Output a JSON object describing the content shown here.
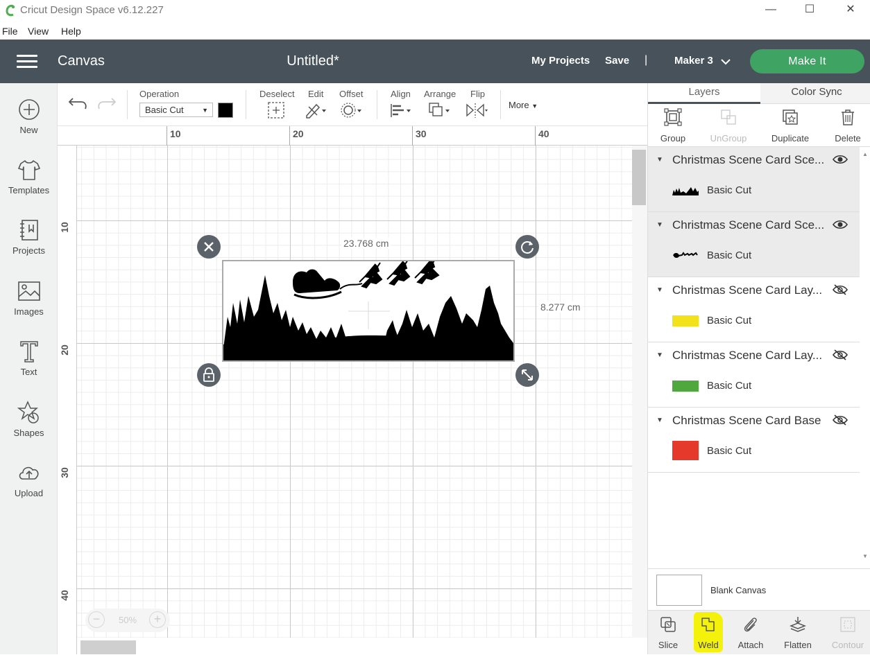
{
  "window": {
    "title": "Cricut Design Space  v6.12.227",
    "controls": {
      "minimize": "—",
      "maximize": "☐",
      "close": "✕"
    }
  },
  "menu": [
    "File",
    "View",
    "Help"
  ],
  "header": {
    "section": "Canvas",
    "document_title": "Untitled*",
    "my_projects": "My Projects",
    "save": "Save",
    "separator": "|",
    "machine": "Maker 3",
    "make_it": "Make It"
  },
  "sidebar": {
    "items": [
      {
        "label": "New",
        "icon": "plus-circle-icon"
      },
      {
        "label": "Templates",
        "icon": "tshirt-icon"
      },
      {
        "label": "Projects",
        "icon": "notebook-icon"
      },
      {
        "label": "Images",
        "icon": "image-icon"
      },
      {
        "label": "Text",
        "icon": "text-icon"
      },
      {
        "label": "Shapes",
        "icon": "shapes-icon"
      },
      {
        "label": "Upload",
        "icon": "cloud-upload-icon"
      }
    ]
  },
  "toolbar": {
    "operation_label": "Operation",
    "operation_value": "Basic Cut",
    "operation_color": "#000000",
    "deselect": "Deselect",
    "edit": "Edit",
    "offset": "Offset",
    "align": "Align",
    "arrange": "Arrange",
    "flip": "Flip",
    "more": "More"
  },
  "canvas": {
    "ruler_top": [
      "10",
      "20",
      "30",
      "40"
    ],
    "ruler_left": [
      "10",
      "20",
      "30",
      "40"
    ],
    "width_label": "23.768 cm",
    "height_label": "8.277 cm",
    "zoom": "50%",
    "zoom_out": "−",
    "zoom_in": "+"
  },
  "right_panel": {
    "tabs": [
      "Layers",
      "Color Sync"
    ],
    "active_tab": "Layers",
    "layer_actions": [
      {
        "label": "Group",
        "enabled": true
      },
      {
        "label": "UnGroup",
        "enabled": false
      },
      {
        "label": "Duplicate",
        "enabled": true
      },
      {
        "label": "Delete",
        "enabled": true
      }
    ],
    "layers": [
      {
        "name": "Christmas Scene Card Sce...",
        "operation": "Basic Cut",
        "color": "#000000",
        "visible": true,
        "selected": true
      },
      {
        "name": "Christmas Scene Card Sce...",
        "operation": "Basic Cut",
        "color": "#000000",
        "visible": true,
        "selected": true
      },
      {
        "name": "Christmas Scene Card Lay...",
        "operation": "Basic Cut",
        "color": "#f2e21b",
        "visible": false,
        "selected": false
      },
      {
        "name": "Christmas Scene Card Lay...",
        "operation": "Basic Cut",
        "color": "#4fa83d",
        "visible": false,
        "selected": false
      },
      {
        "name": "Christmas Scene Card Base",
        "operation": "Basic Cut",
        "color": "#e53a2b",
        "visible": false,
        "selected": false
      }
    ],
    "blank_canvas": "Blank Canvas",
    "bottom_actions": [
      {
        "label": "Slice",
        "enabled": true
      },
      {
        "label": "Weld",
        "enabled": true,
        "highlighted": true
      },
      {
        "label": "Attach",
        "enabled": true
      },
      {
        "label": "Flatten",
        "enabled": true
      },
      {
        "label": "Contour",
        "enabled": false
      }
    ]
  },
  "colors": {
    "header_bg": "#47525a",
    "make_it_green": "#3fa463",
    "weld_highlight": "#f4f10a"
  }
}
